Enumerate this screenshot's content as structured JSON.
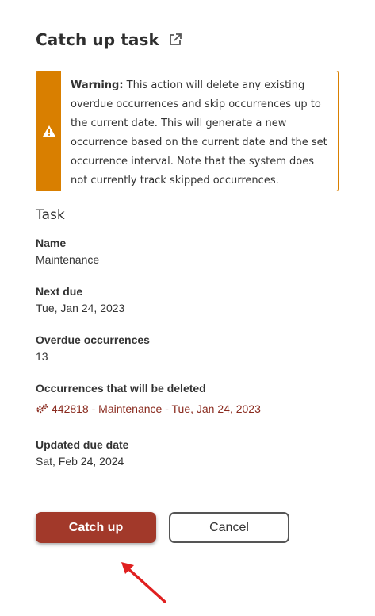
{
  "header": {
    "title": "Catch up task",
    "external_link_icon": "external-link-icon"
  },
  "warning": {
    "icon": "warning-triangle-icon",
    "color": "#d97f00",
    "label": "Warning:",
    "message": "This action will delete any existing overdue occurrences and skip occurrences up to the current date. This will generate a new occurrence based on the current date and the set occurrence interval. Note that the system does not currently track skipped occurrences."
  },
  "task": {
    "heading": "Task",
    "name_label": "Name",
    "name_value": "Maintenance",
    "next_due_label": "Next due",
    "next_due_value": "Tue, Jan 24, 2023",
    "overdue_label": "Overdue occurrences",
    "overdue_value": "13",
    "deleted_label": "Occurrences that will be deleted",
    "deleted_items": [
      {
        "icon": "gears-icon",
        "text": "442818 - Maintenance - Tue, Jan 24, 2023"
      }
    ],
    "updated_due_label": "Updated due date",
    "updated_due_value": "Sat, Feb 24, 2024"
  },
  "actions": {
    "primary_label": "Catch up",
    "secondary_label": "Cancel",
    "primary_color": "#a2392a"
  },
  "annotation": {
    "arrow_color": "#e02020"
  }
}
